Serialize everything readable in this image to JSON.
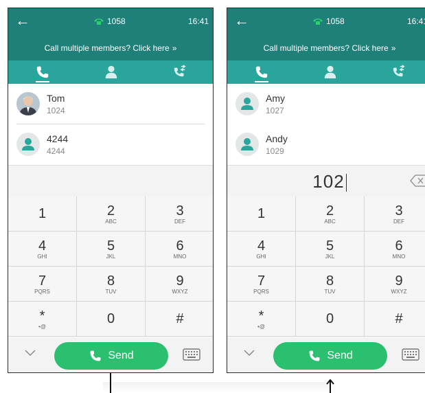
{
  "status": {
    "extension": "1058",
    "time": "16:41"
  },
  "banner": {
    "text": "Call multiple members? Click here",
    "chevron": "»"
  },
  "left": {
    "contacts": [
      {
        "name": "Tom",
        "number": "1024",
        "avatar": "photo"
      },
      {
        "name": "4244",
        "number": "4244",
        "avatar": "person-icon"
      }
    ]
  },
  "right": {
    "contacts": [
      {
        "name": "Amy",
        "number": "1027",
        "avatar": "person-icon"
      },
      {
        "name": "Andy",
        "number": "1029",
        "avatar": "person-icon"
      }
    ],
    "dial_input": "102"
  },
  "keys": [
    {
      "digit": "1",
      "letters": ""
    },
    {
      "digit": "2",
      "letters": "ABC"
    },
    {
      "digit": "3",
      "letters": "DEF"
    },
    {
      "digit": "4",
      "letters": "GHI"
    },
    {
      "digit": "5",
      "letters": "JKL"
    },
    {
      "digit": "6",
      "letters": "MNO"
    },
    {
      "digit": "7",
      "letters": "PQRS"
    },
    {
      "digit": "8",
      "letters": "TUV"
    },
    {
      "digit": "9",
      "letters": "WXYZ"
    },
    {
      "digit": "*",
      "letters": "•@"
    },
    {
      "digit": "0",
      "letters": ""
    },
    {
      "digit": "#",
      "letters": ""
    }
  ],
  "send_label": "Send",
  "colors": {
    "header": "#1f7f79",
    "tabbar": "#2aa59b",
    "send": "#2bbf70"
  }
}
